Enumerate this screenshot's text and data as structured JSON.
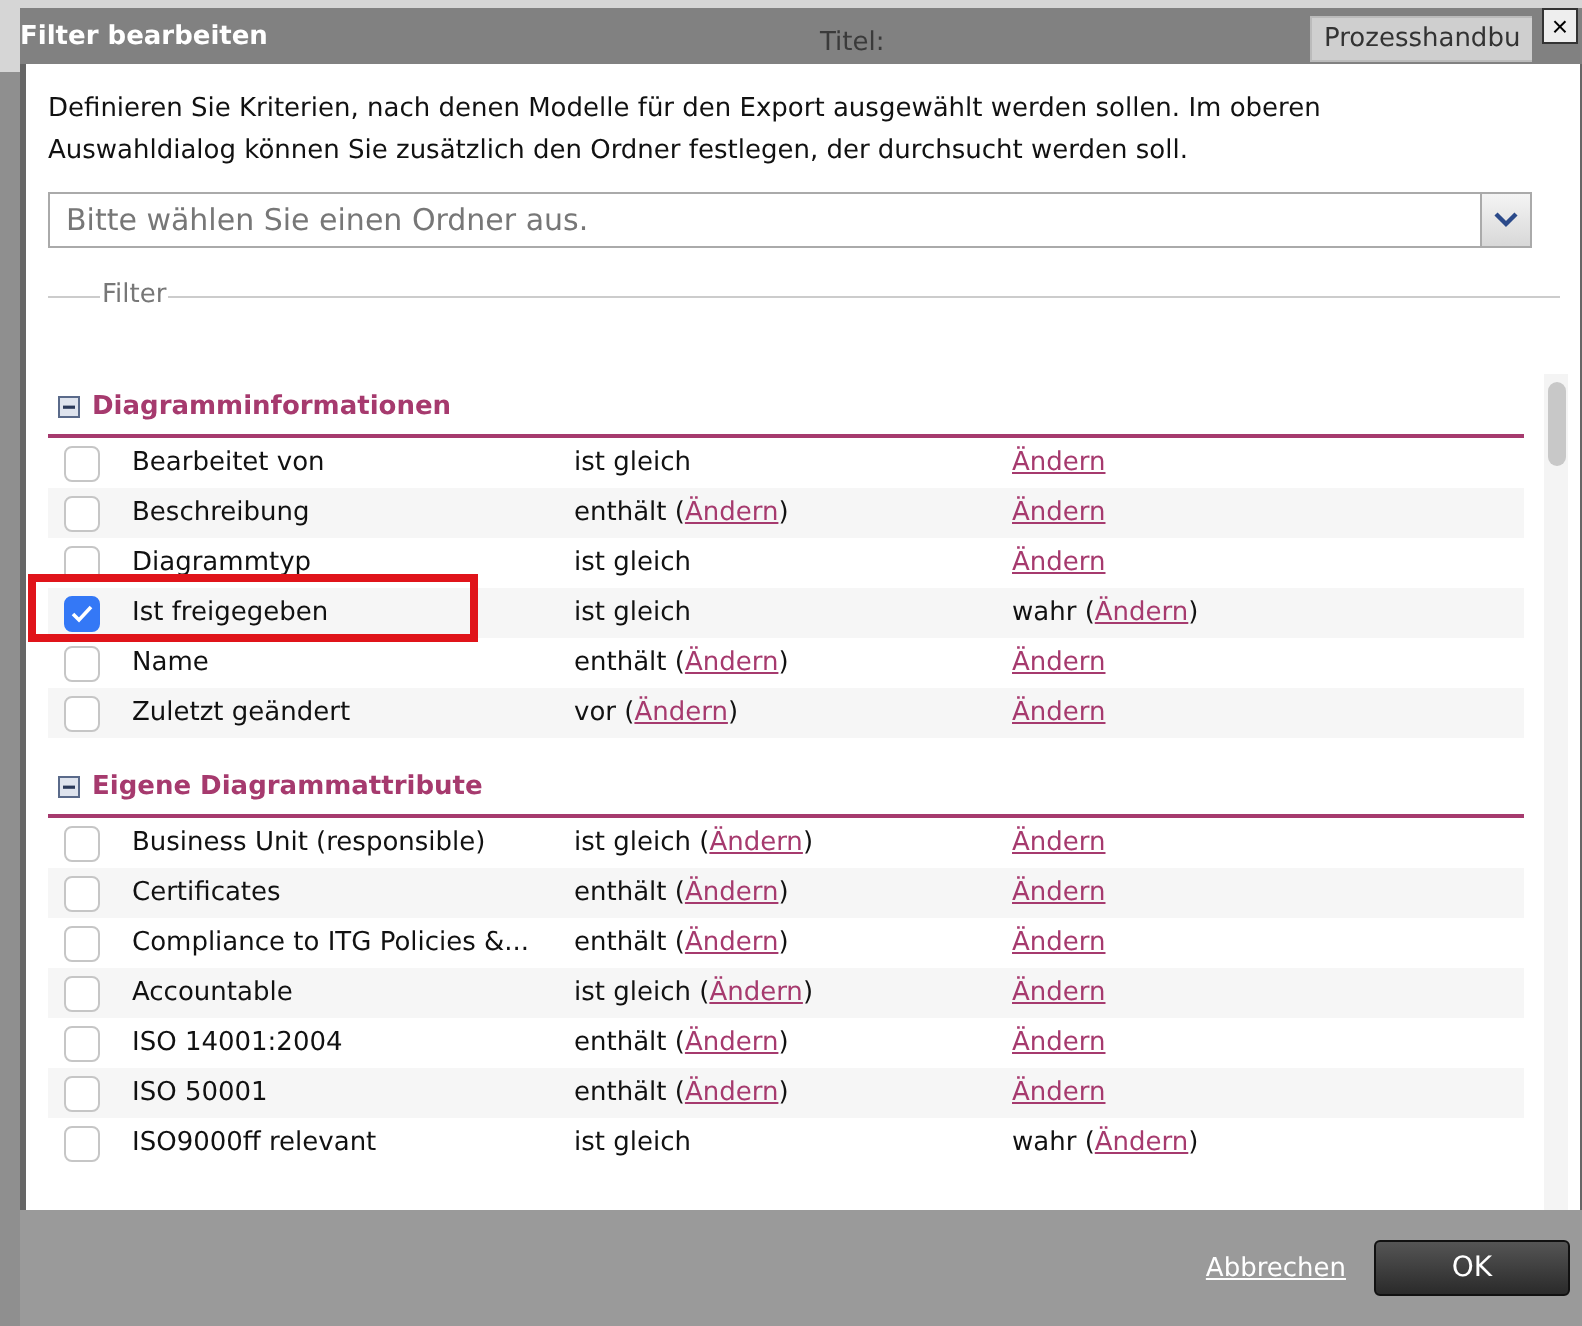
{
  "background": {
    "label": "Titel:",
    "field_value": "Prozesshandbu"
  },
  "dialog": {
    "title": "Filter bearbeiten",
    "close": "×",
    "description": "Definieren Sie Kriterien, nach denen Modelle für den Export ausgewählt werden sollen. Im oberen Auswahldialog können Sie zusätzlich den Ordner festlegen, der durchsucht werden soll.",
    "folder_select": {
      "placeholder": "Bitte wählen Sie einen Ordner aus."
    },
    "filter_legend": "Filter",
    "sections": [
      {
        "title": "Diagramminformationen",
        "expanded": true,
        "rows": [
          {
            "label": "Bearbeitet von",
            "checked": false,
            "highlighted": false,
            "op": {
              "prefix": "ist gleich"
            },
            "value": {
              "link": "Ändern"
            }
          },
          {
            "label": "Beschreibung",
            "checked": false,
            "highlighted": false,
            "op": {
              "prefix": "enthält (",
              "link": "Ändern",
              "suffix": ")"
            },
            "value": {
              "link": "Ändern"
            }
          },
          {
            "label": "Diagrammtyp",
            "checked": false,
            "highlighted": false,
            "op": {
              "prefix": "ist gleich"
            },
            "value": {
              "link": "Ändern"
            }
          },
          {
            "label": "Ist freigegeben",
            "checked": true,
            "highlighted": true,
            "op": {
              "prefix": "ist gleich"
            },
            "value": {
              "prefix": "wahr (",
              "link": "Ändern",
              "suffix": ")"
            }
          },
          {
            "label": "Name",
            "checked": false,
            "highlighted": false,
            "op": {
              "prefix": "enthält (",
              "link": "Ändern",
              "suffix": ")"
            },
            "value": {
              "link": "Ändern"
            }
          },
          {
            "label": "Zuletzt geändert",
            "checked": false,
            "highlighted": false,
            "op": {
              "prefix": "vor (",
              "link": "Ändern",
              "suffix": ")"
            },
            "value": {
              "link": "Ändern"
            }
          }
        ]
      },
      {
        "title": "Eigene Diagrammattribute",
        "expanded": true,
        "rows": [
          {
            "label": "Business Unit (responsible)",
            "checked": false,
            "highlighted": false,
            "op": {
              "prefix": "ist gleich (",
              "link": "Ändern",
              "suffix": ")"
            },
            "value": {
              "link": "Ändern"
            }
          },
          {
            "label": "Certificates",
            "checked": false,
            "highlighted": false,
            "op": {
              "prefix": "enthält (",
              "link": "Ändern",
              "suffix": ")"
            },
            "value": {
              "link": "Ändern"
            }
          },
          {
            "label": "Compliance to ITG Policies &...",
            "checked": false,
            "highlighted": false,
            "op": {
              "prefix": "enthält (",
              "link": "Ändern",
              "suffix": ")"
            },
            "value": {
              "link": "Ändern"
            }
          },
          {
            "label": "Accountable",
            "checked": false,
            "highlighted": false,
            "op": {
              "prefix": "ist gleich (",
              "link": "Ändern",
              "suffix": ")"
            },
            "value": {
              "link": "Ändern"
            }
          },
          {
            "label": "ISO 14001:2004",
            "checked": false,
            "highlighted": false,
            "op": {
              "prefix": "enthält (",
              "link": "Ändern",
              "suffix": ")"
            },
            "value": {
              "link": "Ändern"
            }
          },
          {
            "label": "ISO 50001",
            "checked": false,
            "highlighted": false,
            "op": {
              "prefix": "enthält (",
              "link": "Ändern",
              "suffix": ")"
            },
            "value": {
              "link": "Ändern"
            }
          },
          {
            "label": "ISO9000ff relevant",
            "checked": false,
            "highlighted": false,
            "op": {
              "prefix": "ist gleich"
            },
            "value": {
              "prefix": "wahr (",
              "link": "Ändern",
              "suffix": ")"
            }
          }
        ]
      }
    ],
    "buttons": {
      "cancel": "Abbrechen",
      "ok": "OK"
    }
  }
}
